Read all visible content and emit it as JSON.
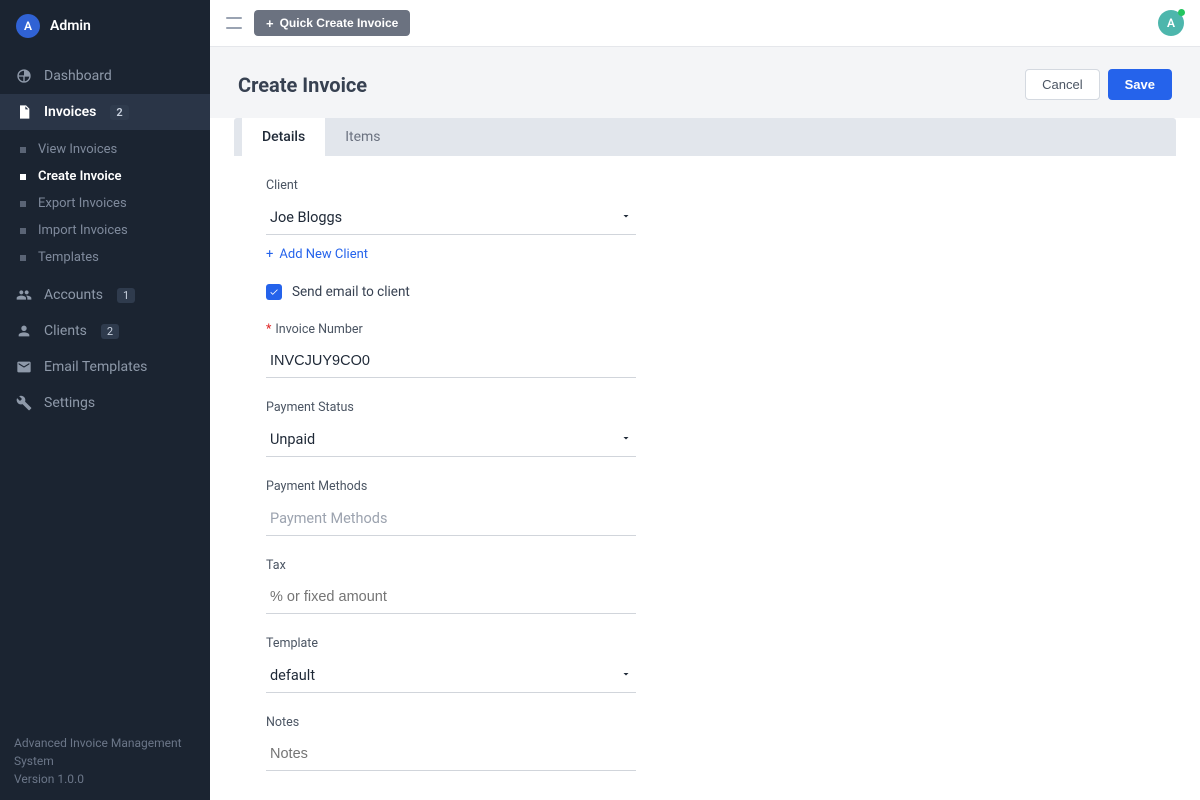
{
  "sidebar": {
    "user_initial": "A",
    "user_name": "Admin",
    "items": [
      {
        "label": "Dashboard"
      },
      {
        "label": "Invoices",
        "badge": "2"
      },
      {
        "label": "Accounts",
        "badge": "1"
      },
      {
        "label": "Clients",
        "badge": "2"
      },
      {
        "label": "Email Templates"
      },
      {
        "label": "Settings"
      }
    ],
    "invoices_sub": [
      {
        "label": "View Invoices"
      },
      {
        "label": "Create Invoice"
      },
      {
        "label": "Export Invoices"
      },
      {
        "label": "Import Invoices"
      },
      {
        "label": "Templates"
      }
    ],
    "footer_line1": "Advanced Invoice Management System",
    "footer_line2": "Version 1.0.0"
  },
  "topbar": {
    "quick_create": "Quick Create Invoice",
    "avatar_initial": "A"
  },
  "page": {
    "title": "Create Invoice",
    "cancel": "Cancel",
    "save": "Save"
  },
  "tabs": {
    "details": "Details",
    "items": "Items"
  },
  "form": {
    "client_label": "Client",
    "client_value": "Joe Bloggs",
    "add_client": "Add New Client",
    "send_email": "Send email to client",
    "invoice_number_label": "Invoice Number",
    "invoice_number_value": "INVCJUY9CO0",
    "payment_status_label": "Payment Status",
    "payment_status_value": "Unpaid",
    "payment_methods_label": "Payment Methods",
    "payment_methods_placeholder": "Payment Methods",
    "tax_label": "Tax",
    "tax_placeholder": "% or fixed amount",
    "template_label": "Template",
    "template_value": "default",
    "notes_label": "Notes",
    "notes_placeholder": "Notes"
  }
}
